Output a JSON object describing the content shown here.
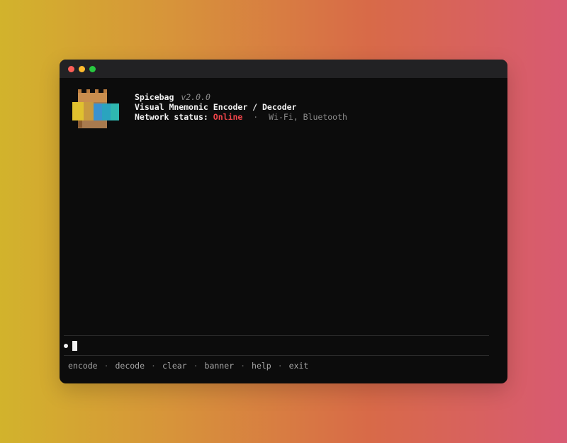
{
  "window": {
    "controls": [
      "close",
      "minimize",
      "zoom"
    ]
  },
  "banner": {
    "app_name": "Spicebag",
    "version": "v2.0.0",
    "subtitle": "Visual Mnemonic Encoder / Decoder",
    "status_label": "Network status:",
    "status_value": "Online",
    "separator": "·",
    "channels": "Wi-Fi, Bluetooth",
    "logo_icon": "spice-bag-icon"
  },
  "colors": {
    "status_online": "#f0454a",
    "terminal_bg": "#0c0c0c"
  },
  "prompt": {
    "input_value": ""
  },
  "commands": {
    "encode": "encode",
    "decode": "decode",
    "clear": "clear",
    "banner": "banner",
    "help": "help",
    "exit": "exit",
    "separator": "·"
  }
}
